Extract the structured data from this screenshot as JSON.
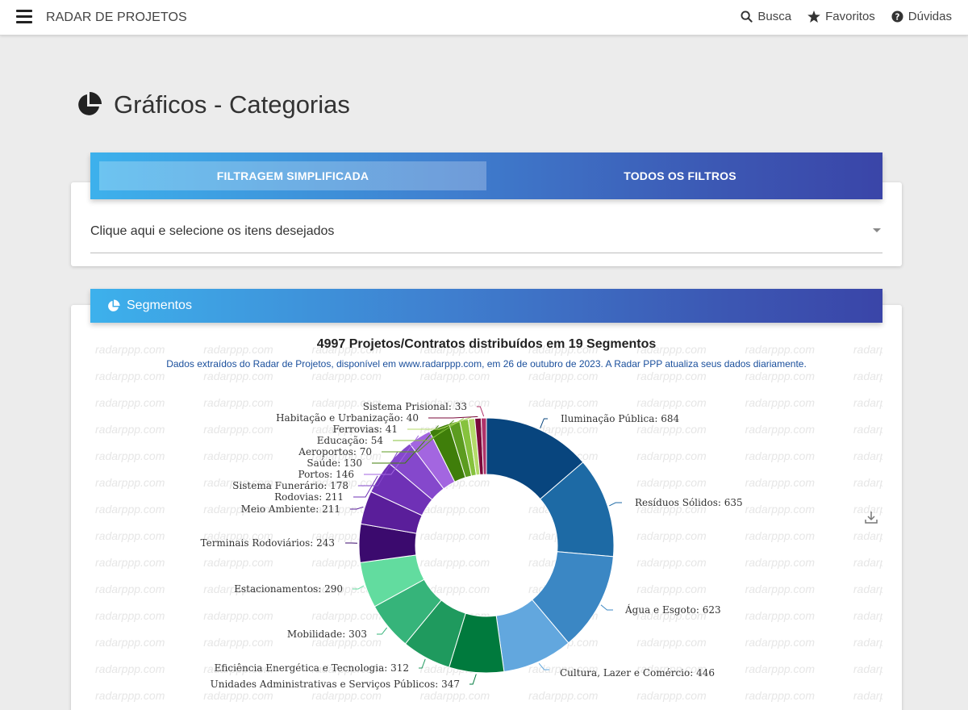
{
  "app": {
    "brand": "RADAR DE PROJETOS"
  },
  "nav": {
    "search_label": "Busca",
    "favorites_label": "Favoritos",
    "help_label": "Dúvidas"
  },
  "page": {
    "title": "Gráficos - Categorias"
  },
  "filters": {
    "tab_simple": "FILTRAGEM SIMPLIFICADA",
    "tab_all": "TODOS OS FILTROS",
    "select_placeholder": "Clique aqui e selecione os itens desejados"
  },
  "segments_panel": {
    "title": "Segmentos",
    "watermark": "radarppp.com"
  },
  "colors": {
    "header_gradient_start": "#3db1ec",
    "header_gradient_end": "#3a45a8"
  },
  "chart_data": {
    "type": "pie",
    "title": "4997 Projetos/Contratos distribuídos em 19 Segmentos",
    "subtitle": "Dados extraídos do Radar de Projetos, disponível em www.radarppp.com, em 26 de outubro de 2023. A Radar PPP atualiza seus dados diariamente.",
    "categories": [
      "Iluminação Pública",
      "Resíduos Sólidos",
      "Água e Esgoto",
      "Cultura, Lazer e Comércio",
      "Unidades Administrativas e Serviços Públicos",
      "Eficiência Energética e Tecnologia",
      "Mobilidade",
      "Estacionamentos",
      "Terminais Rodoviários",
      "Meio Ambiente",
      "Rodovias",
      "Sistema Funerário",
      "Portos",
      "Saúde",
      "Aeroportos",
      "Educação",
      "Ferrovias",
      "Habitação e Urbanização",
      "Sistema Prisional"
    ],
    "values": [
      684,
      635,
      623,
      446,
      347,
      312,
      303,
      290,
      243,
      211,
      211,
      178,
      146,
      130,
      70,
      54,
      41,
      40,
      33
    ],
    "colors": [
      "#08457e",
      "#1d6aa5",
      "#3b87c4",
      "#62a7de",
      "#007a3d",
      "#1f9a5e",
      "#36b47a",
      "#62dc9f",
      "#3b0a6e",
      "#5a1e9a",
      "#6f31b6",
      "#8548cc",
      "#a366e0",
      "#3f7e0a",
      "#5c9c20",
      "#86c23d",
      "#b4db6a",
      "#7a0a3a",
      "#b0336a"
    ]
  }
}
